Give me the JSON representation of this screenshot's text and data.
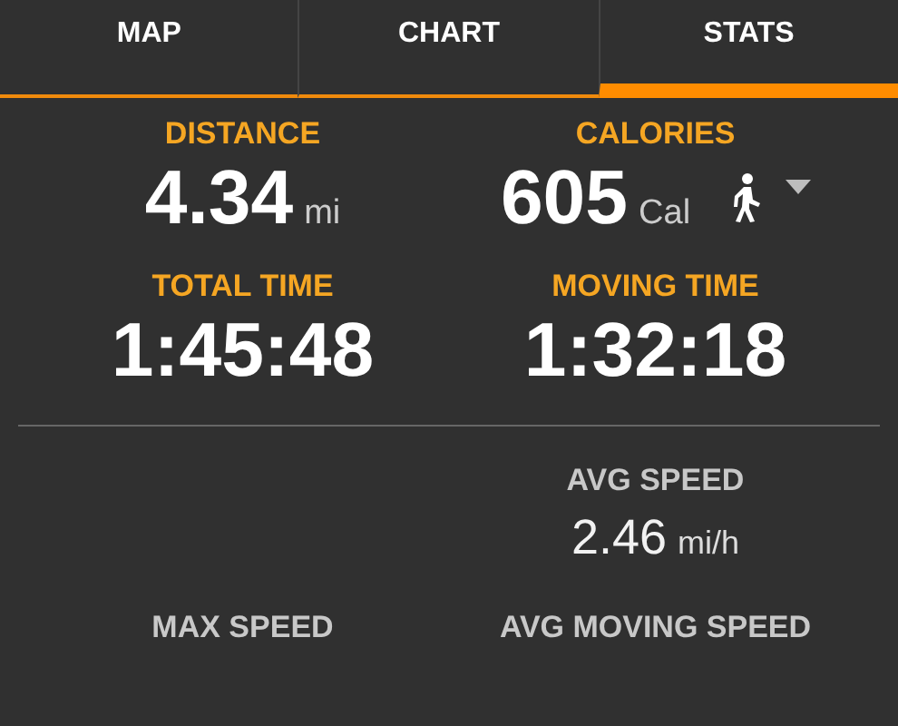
{
  "tabs": [
    {
      "label": "MAP",
      "selected": false
    },
    {
      "label": "CHART",
      "selected": false
    },
    {
      "label": "STATS",
      "selected": true
    }
  ],
  "primary_stats": [
    {
      "label": "DISTANCE",
      "value": "4.34",
      "unit": "mi"
    },
    {
      "label": "CALORIES",
      "value": "605",
      "unit": "Cal",
      "kind": "activity"
    },
    {
      "label": "TOTAL TIME",
      "value": "1:45:48"
    },
    {
      "label": "MOVING TIME",
      "value": "1:32:18"
    }
  ],
  "secondary_stats": [
    {
      "kind": "blank"
    },
    {
      "kind": "stat",
      "label": "AVG SPEED",
      "value": "2.46",
      "unit": "mi/h"
    },
    {
      "kind": "stat",
      "label": "MAX SPEED"
    },
    {
      "kind": "stat",
      "label": "AVG MOVING SPEED"
    }
  ]
}
